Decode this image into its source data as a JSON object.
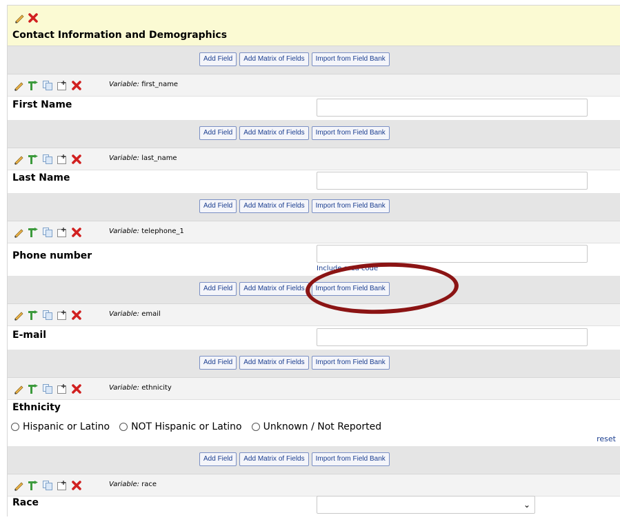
{
  "section": {
    "title": "Contact Information and Demographics"
  },
  "add_bar": {
    "add_field": "Add Field",
    "add_matrix": "Add Matrix of Fields",
    "import_bank": "Import from Field Bank"
  },
  "variable_label": "Variable:",
  "fields": [
    {
      "variable": "first_name",
      "label": "First Name",
      "type": "text",
      "value": ""
    },
    {
      "variable": "last_name",
      "label": "Last Name",
      "type": "text",
      "value": ""
    },
    {
      "variable": "telephone_1",
      "label": "Phone number",
      "type": "text",
      "value": "",
      "note": "Include area code"
    },
    {
      "variable": "email",
      "label": "E-mail",
      "type": "text",
      "value": ""
    },
    {
      "variable": "ethnicity",
      "label": "Ethnicity",
      "type": "radio",
      "options": [
        "Hispanic or Latino",
        "NOT Hispanic or Latino",
        "Unknown / Not Reported"
      ],
      "reset": "reset"
    },
    {
      "variable": "race",
      "label": "Race",
      "type": "select",
      "value": ""
    }
  ],
  "icons": {
    "edit": "pencil-icon",
    "branch": "branching-logic-icon",
    "copy": "copy-icon",
    "move": "move-icon",
    "delete": "delete-icon"
  },
  "colors": {
    "section_bg": "#fbfad3",
    "bar_bg": "#e5e5e5",
    "button_text": "#1a3d8f",
    "annotation": "#8b1414"
  }
}
